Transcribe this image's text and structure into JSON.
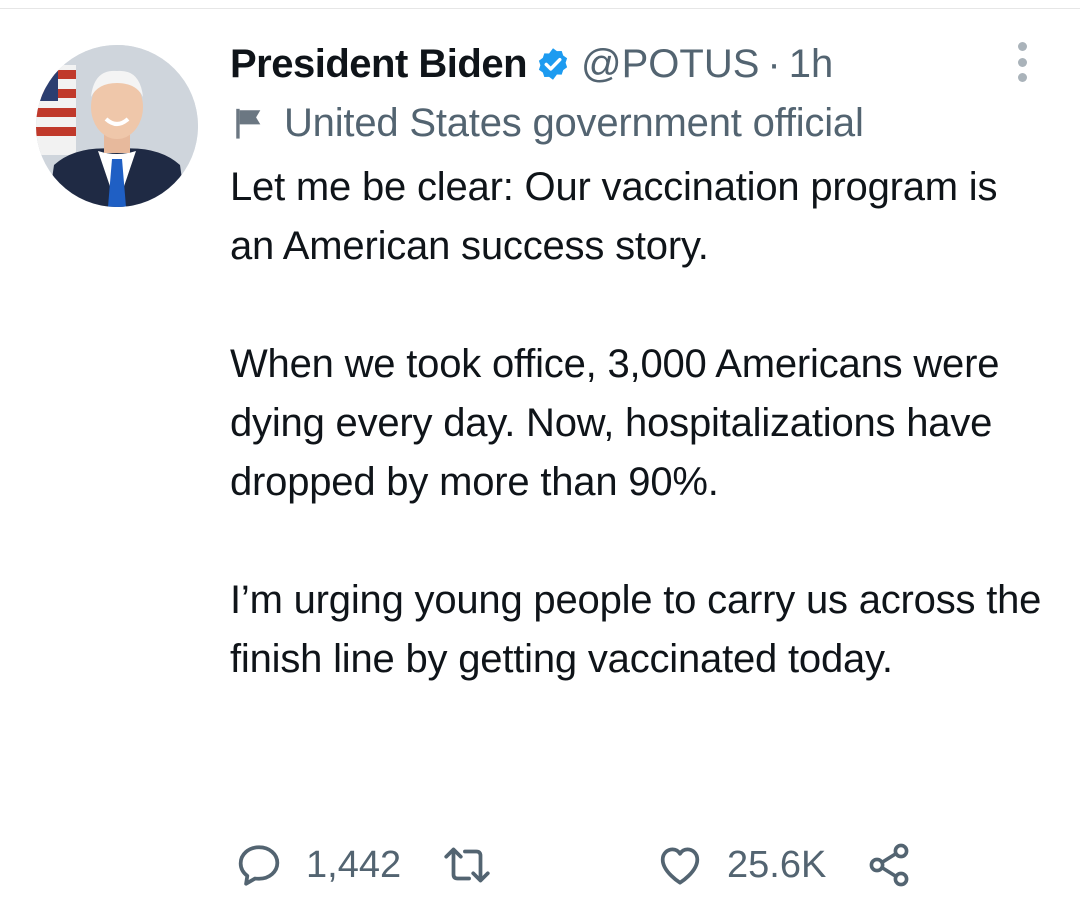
{
  "tweet": {
    "author": {
      "display_name": "President Biden",
      "handle": "@POTUS",
      "verified": true,
      "avatar_icon": "avatar-photo"
    },
    "separator": "·",
    "timestamp": "1h",
    "label": {
      "icon": "flag-icon",
      "text": "United States government official"
    },
    "paragraphs": [
      "Let me be clear: Our vaccination program is an American success story.",
      "When we took office, 3,000 Americans were dying every day. Now, hospitalizations have dropped by more than 90%.",
      "I’m urging young people to carry us across the finish line by getting vaccinated today."
    ],
    "actions": {
      "reply": {
        "icon": "reply-icon",
        "count": "1,442"
      },
      "retweet": {
        "icon": "retweet-icon",
        "count": ""
      },
      "like": {
        "icon": "heart-icon",
        "count": "25.6K"
      },
      "share": {
        "icon": "share-icon"
      }
    },
    "more_icon": "more-options-icon"
  },
  "colors": {
    "verified": "#1d9bf0",
    "secondary_text": "#536471",
    "primary_text": "#0f1419"
  }
}
